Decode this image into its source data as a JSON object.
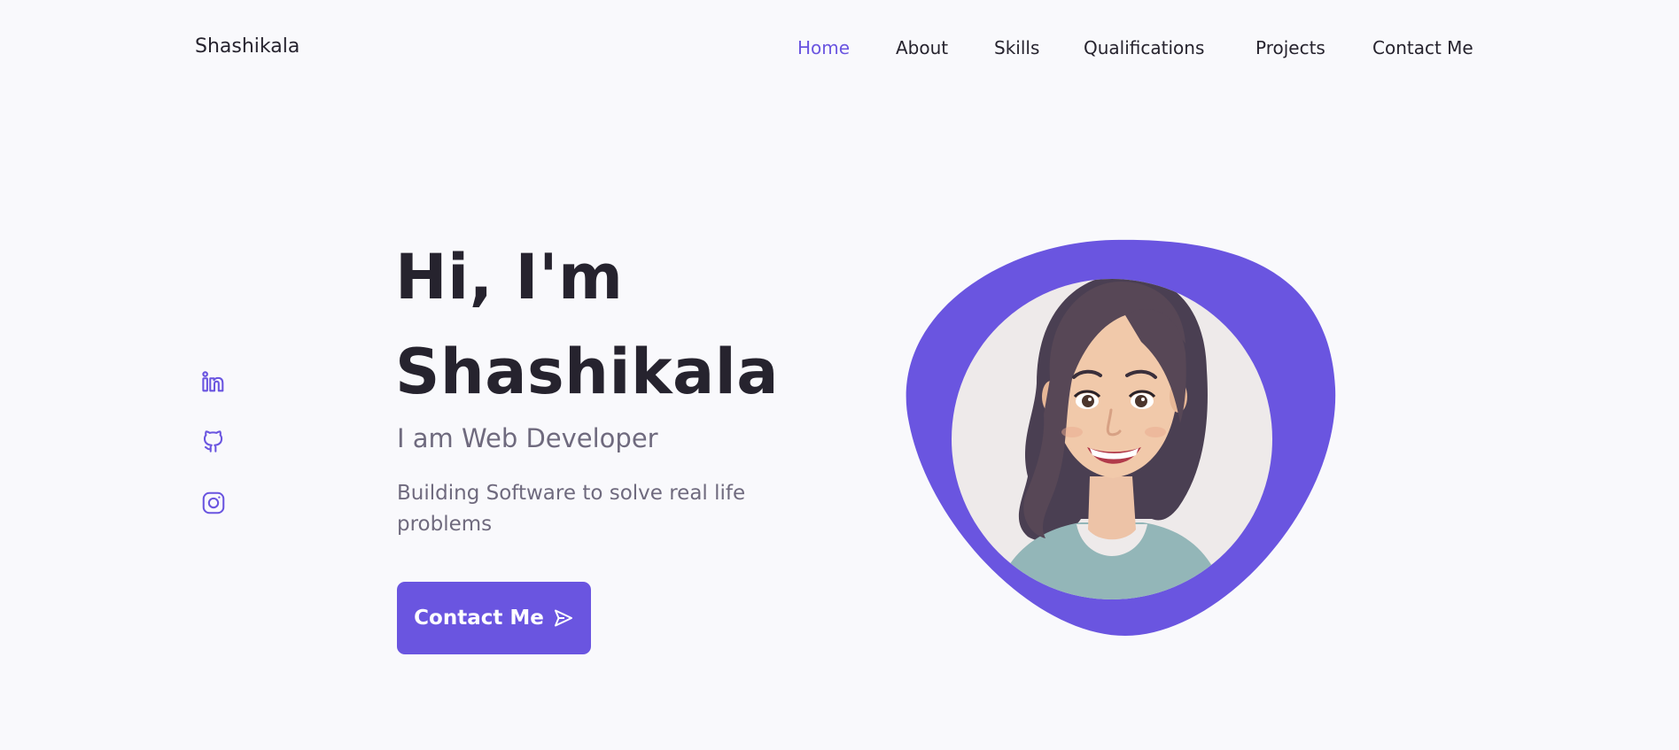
{
  "header": {
    "logo": "Shashikala",
    "nav": [
      {
        "label": "Home",
        "active": true
      },
      {
        "label": "About",
        "active": false
      },
      {
        "label": "Skills",
        "active": false
      },
      {
        "label": "Qualifications",
        "active": false
      },
      {
        "label": "Projects",
        "active": false
      },
      {
        "label": "Contact Me",
        "active": false
      }
    ]
  },
  "social": [
    {
      "icon": "linkedin-icon"
    },
    {
      "icon": "github-icon"
    },
    {
      "icon": "instagram-icon"
    }
  ],
  "hero": {
    "title_line1": "Hi, I'm",
    "title_line2": "Shashikala",
    "subtitle": "I am Web Developer",
    "description": "Building Software to solve real life problems",
    "button_label": "Contact Me",
    "button_icon": "send-icon"
  },
  "colors": {
    "accent": "#6a55e0",
    "background": "#f9f9fc",
    "title": "#26232e",
    "muted_text": "#6f6a7e"
  },
  "avatar": {
    "icon": "avatar-illustration"
  }
}
